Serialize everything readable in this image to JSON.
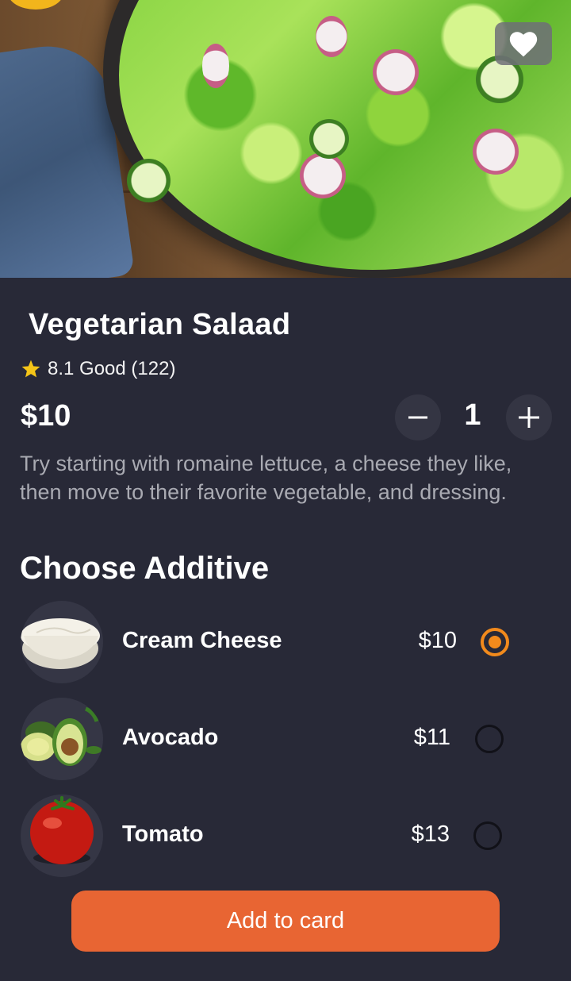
{
  "product": {
    "title": "Vegetarian Salaad",
    "rating_text": "8.1 Good (122)",
    "price": "$10",
    "quantity": "1",
    "description": "Try starting with romaine lettuce, a cheese they like, then move to their favorite vegetable, and dressing."
  },
  "additives": {
    "heading": "Choose Additive",
    "items": [
      {
        "name": "Cream Cheese",
        "price": "$10",
        "selected": true,
        "icon": "cream-cheese"
      },
      {
        "name": "Avocado",
        "price": "$11",
        "selected": false,
        "icon": "avocado"
      },
      {
        "name": "Tomato",
        "price": "$13",
        "selected": false,
        "icon": "tomato"
      }
    ]
  },
  "actions": {
    "add_label": "Add to card",
    "favorite_icon": "heart-icon",
    "decrease_icon": "minus-icon",
    "increase_icon": "plus-icon"
  },
  "colors": {
    "background": "#282937",
    "accent": "#e86533",
    "radio_selected": "#f28a1c",
    "star": "#f5c518"
  }
}
